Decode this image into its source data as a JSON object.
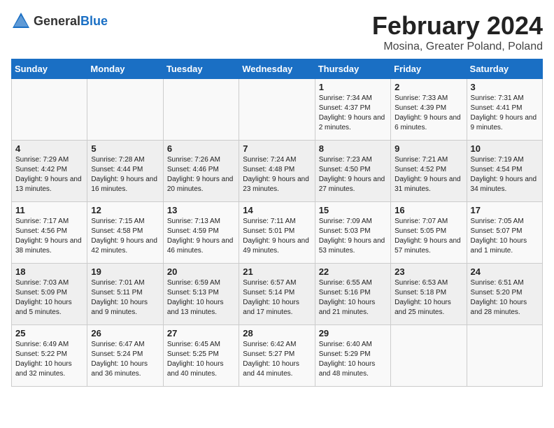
{
  "logo": {
    "general": "General",
    "blue": "Blue"
  },
  "title": "February 2024",
  "location": "Mosina, Greater Poland, Poland",
  "days": [
    "Sunday",
    "Monday",
    "Tuesday",
    "Wednesday",
    "Thursday",
    "Friday",
    "Saturday"
  ],
  "weeks": [
    [
      {
        "day": "",
        "info": ""
      },
      {
        "day": "",
        "info": ""
      },
      {
        "day": "",
        "info": ""
      },
      {
        "day": "",
        "info": ""
      },
      {
        "day": "1",
        "info": "Sunrise: 7:34 AM\nSunset: 4:37 PM\nDaylight: 9 hours\nand 2 minutes."
      },
      {
        "day": "2",
        "info": "Sunrise: 7:33 AM\nSunset: 4:39 PM\nDaylight: 9 hours\nand 6 minutes."
      },
      {
        "day": "3",
        "info": "Sunrise: 7:31 AM\nSunset: 4:41 PM\nDaylight: 9 hours\nand 9 minutes."
      }
    ],
    [
      {
        "day": "4",
        "info": "Sunrise: 7:29 AM\nSunset: 4:42 PM\nDaylight: 9 hours\nand 13 minutes."
      },
      {
        "day": "5",
        "info": "Sunrise: 7:28 AM\nSunset: 4:44 PM\nDaylight: 9 hours\nand 16 minutes."
      },
      {
        "day": "6",
        "info": "Sunrise: 7:26 AM\nSunset: 4:46 PM\nDaylight: 9 hours\nand 20 minutes."
      },
      {
        "day": "7",
        "info": "Sunrise: 7:24 AM\nSunset: 4:48 PM\nDaylight: 9 hours\nand 23 minutes."
      },
      {
        "day": "8",
        "info": "Sunrise: 7:23 AM\nSunset: 4:50 PM\nDaylight: 9 hours\nand 27 minutes."
      },
      {
        "day": "9",
        "info": "Sunrise: 7:21 AM\nSunset: 4:52 PM\nDaylight: 9 hours\nand 31 minutes."
      },
      {
        "day": "10",
        "info": "Sunrise: 7:19 AM\nSunset: 4:54 PM\nDaylight: 9 hours\nand 34 minutes."
      }
    ],
    [
      {
        "day": "11",
        "info": "Sunrise: 7:17 AM\nSunset: 4:56 PM\nDaylight: 9 hours\nand 38 minutes."
      },
      {
        "day": "12",
        "info": "Sunrise: 7:15 AM\nSunset: 4:58 PM\nDaylight: 9 hours\nand 42 minutes."
      },
      {
        "day": "13",
        "info": "Sunrise: 7:13 AM\nSunset: 4:59 PM\nDaylight: 9 hours\nand 46 minutes."
      },
      {
        "day": "14",
        "info": "Sunrise: 7:11 AM\nSunset: 5:01 PM\nDaylight: 9 hours\nand 49 minutes."
      },
      {
        "day": "15",
        "info": "Sunrise: 7:09 AM\nSunset: 5:03 PM\nDaylight: 9 hours\nand 53 minutes."
      },
      {
        "day": "16",
        "info": "Sunrise: 7:07 AM\nSunset: 5:05 PM\nDaylight: 9 hours\nand 57 minutes."
      },
      {
        "day": "17",
        "info": "Sunrise: 7:05 AM\nSunset: 5:07 PM\nDaylight: 10 hours\nand 1 minute."
      }
    ],
    [
      {
        "day": "18",
        "info": "Sunrise: 7:03 AM\nSunset: 5:09 PM\nDaylight: 10 hours\nand 5 minutes."
      },
      {
        "day": "19",
        "info": "Sunrise: 7:01 AM\nSunset: 5:11 PM\nDaylight: 10 hours\nand 9 minutes."
      },
      {
        "day": "20",
        "info": "Sunrise: 6:59 AM\nSunset: 5:13 PM\nDaylight: 10 hours\nand 13 minutes."
      },
      {
        "day": "21",
        "info": "Sunrise: 6:57 AM\nSunset: 5:14 PM\nDaylight: 10 hours\nand 17 minutes."
      },
      {
        "day": "22",
        "info": "Sunrise: 6:55 AM\nSunset: 5:16 PM\nDaylight: 10 hours\nand 21 minutes."
      },
      {
        "day": "23",
        "info": "Sunrise: 6:53 AM\nSunset: 5:18 PM\nDaylight: 10 hours\nand 25 minutes."
      },
      {
        "day": "24",
        "info": "Sunrise: 6:51 AM\nSunset: 5:20 PM\nDaylight: 10 hours\nand 28 minutes."
      }
    ],
    [
      {
        "day": "25",
        "info": "Sunrise: 6:49 AM\nSunset: 5:22 PM\nDaylight: 10 hours\nand 32 minutes."
      },
      {
        "day": "26",
        "info": "Sunrise: 6:47 AM\nSunset: 5:24 PM\nDaylight: 10 hours\nand 36 minutes."
      },
      {
        "day": "27",
        "info": "Sunrise: 6:45 AM\nSunset: 5:25 PM\nDaylight: 10 hours\nand 40 minutes."
      },
      {
        "day": "28",
        "info": "Sunrise: 6:42 AM\nSunset: 5:27 PM\nDaylight: 10 hours\nand 44 minutes."
      },
      {
        "day": "29",
        "info": "Sunrise: 6:40 AM\nSunset: 5:29 PM\nDaylight: 10 hours\nand 48 minutes."
      },
      {
        "day": "",
        "info": ""
      },
      {
        "day": "",
        "info": ""
      }
    ]
  ]
}
